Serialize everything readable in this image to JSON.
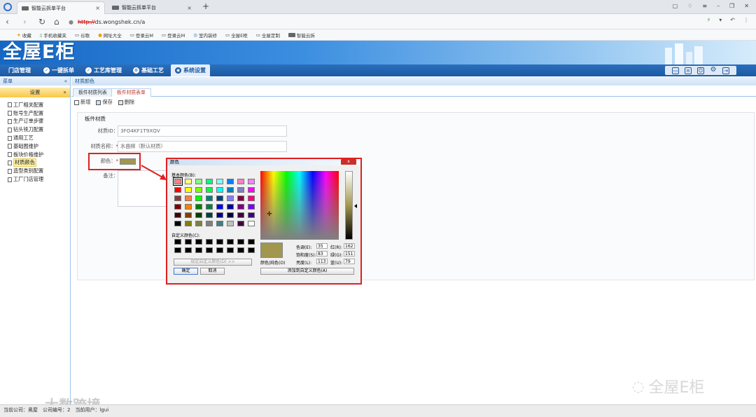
{
  "browser": {
    "tabs": [
      {
        "label": "智能云拆单平台"
      },
      {
        "label": "智能云拆单平台"
      }
    ],
    "new_tab": "+",
    "url_scheme": "http://",
    "url_rest": "ds.wongshek.cn/a",
    "bookmarks": [
      {
        "label": "收藏"
      },
      {
        "label": "手机收藏夹"
      },
      {
        "label": "谷歌"
      },
      {
        "label": "网址大全"
      },
      {
        "label": "登录云M"
      },
      {
        "label": "登录云M"
      },
      {
        "label": "室内装修"
      },
      {
        "label": "全屋E柜"
      },
      {
        "label": "全屋定制"
      },
      {
        "label": "智能云拆"
      }
    ]
  },
  "app": {
    "brand": "全屋E柜",
    "menu": [
      {
        "label": "门店管理"
      },
      {
        "label": "一键拆单"
      },
      {
        "label": "工艺库管理"
      },
      {
        "label": "基础工艺"
      },
      {
        "label": "系统设置"
      }
    ]
  },
  "sidebar": {
    "header": "菜单",
    "collapse": "«",
    "section": "设置",
    "section_toggle": "»",
    "items": [
      {
        "label": "工厂相关配置"
      },
      {
        "label": "账号生产配置"
      },
      {
        "label": "生产订单步骤"
      },
      {
        "label": "钻头铣刀配置"
      },
      {
        "label": "通用工艺"
      },
      {
        "label": "基础图维护"
      },
      {
        "label": "板块价格维护"
      },
      {
        "label": "材质颜色"
      },
      {
        "label": "造型类别配置"
      },
      {
        "label": "工厂门店管理"
      }
    ]
  },
  "main": {
    "breadcrumb": "材质颜色",
    "tabs": [
      {
        "label": "板件材质列表"
      },
      {
        "label": "板件材质表单"
      }
    ],
    "toolbar": {
      "new": "新增",
      "save": "保存",
      "delete": "删除"
    },
    "form": {
      "title": "板件材质",
      "id_label": "材质ID：",
      "id_value": "3FO4KF1T9XQV",
      "name_label": "材质名称：",
      "name_value": "水曲柳（默认材质）",
      "color_label": "颜色：",
      "remark_label": "备注：",
      "required_mark": "*"
    }
  },
  "dialog": {
    "title": "颜色",
    "close": "x",
    "basic_label": "基本颜色(B):",
    "custom_label": "自定义颜色(C):",
    "define_button": "规定自定义颜色(D) >>",
    "ok": "确定",
    "cancel": "取消",
    "hue_label": "色调(E):",
    "hue": "35",
    "sat_label": "饱和度(S):",
    "sat": "83",
    "lum_label": "亮度(L):",
    "lum": "113",
    "red_label": "红(R):",
    "red": "162",
    "green_label": "绿(G):",
    "green": "151",
    "blue_label": "蓝(U):",
    "blue": "79",
    "solid_label": "颜色|纯色(O)",
    "add_custom": "添加到自定义颜色(A)",
    "selected_color": "#a2974f",
    "basic_colors": [
      "#ff8080",
      "#ffff80",
      "#80ff80",
      "#00ff80",
      "#80ffff",
      "#0080ff",
      "#ff80c0",
      "#ff80ff",
      "#ff0000",
      "#ffff00",
      "#80ff00",
      "#00ff40",
      "#00ffff",
      "#0080c0",
      "#8080c0",
      "#ff00ff",
      "#804040",
      "#ff8040",
      "#00ff00",
      "#008080",
      "#004080",
      "#8080ff",
      "#800040",
      "#ff0080",
      "#800000",
      "#ff8000",
      "#008000",
      "#008040",
      "#0000ff",
      "#0000a0",
      "#800080",
      "#8000ff",
      "#400000",
      "#804000",
      "#004000",
      "#004040",
      "#000080",
      "#000040",
      "#400040",
      "#400080",
      "#000000",
      "#808000",
      "#808040",
      "#808080",
      "#408080",
      "#c0c0c0",
      "#400040",
      "#ffffff"
    ],
    "custom_colors": [
      "#000000",
      "#000000",
      "#000000",
      "#000000",
      "#000000",
      "#000000",
      "#000000",
      "#000000",
      "#000000",
      "#000000",
      "#000000",
      "#000000",
      "#000000",
      "#000000",
      "#000000",
      "#000000"
    ]
  },
  "watermarks": {
    "right": "全屋E柜",
    "left": "大数跨境"
  },
  "status": "当前公司：奥屋　公司编号：2　当前用户：lgui"
}
